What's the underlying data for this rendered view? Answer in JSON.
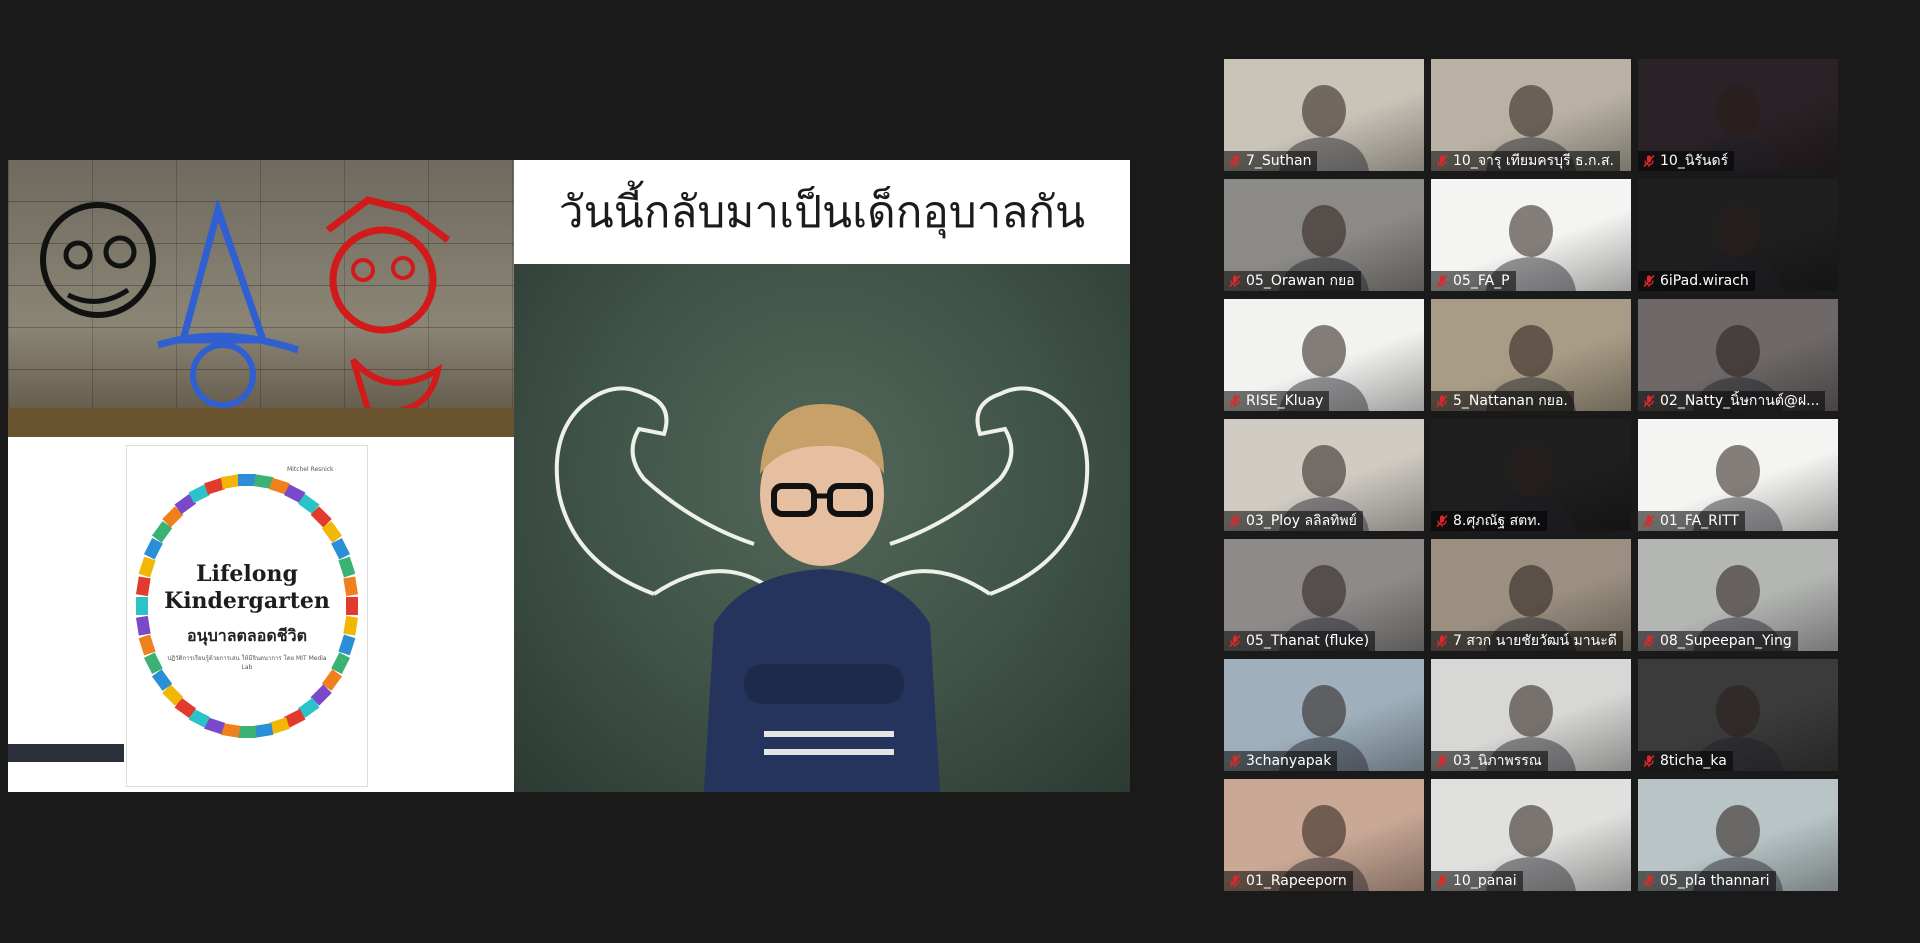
{
  "shared_screen": {
    "slide_title": "วันนี้กลับมาเป็นเด็กอุบาลกัน",
    "book": {
      "author": "Mitchel Resnick",
      "title_line1": "Lifelong",
      "title_line2": "Kindergarten",
      "thai_title": "อนุบาลตลอดชีวิต",
      "subtitle": "ปฏิวัติการเรียนรู้ด้วยการเล่น ให้มีจินตนาการ โดย MIT Media Lab"
    }
  },
  "participants": [
    {
      "name": "7_Suthan",
      "bg": "#c9c4b8",
      "muted": true
    },
    {
      "name": "10_จารุ  เทียมครบุรี  ธ.ก.ส.",
      "bg": "#b9b2a4",
      "muted": true
    },
    {
      "name": "10_นิรันดร์",
      "bg": "#2a2226",
      "muted": true
    },
    {
      "name": "05_Orawan กยอ",
      "bg": "#8c8a86",
      "muted": true
    },
    {
      "name": "05_FA_P",
      "bg": "#f4f4f2",
      "muted": true
    },
    {
      "name": "6iPad.wirach",
      "bg": "#1f1f1f",
      "muted": true
    },
    {
      "name": "RISE_Kluay",
      "bg": "#f2f2f0",
      "muted": true
    },
    {
      "name": "5_Nattanan กยอ.",
      "bg": "#a89c86",
      "muted": true
    },
    {
      "name": "02_Natty_นิ้ษกานต์@ฝ...",
      "bg": "#6e6868",
      "muted": true
    },
    {
      "name": "03_Ploy ลลิลทิพย์",
      "bg": "#d0ccc4",
      "muted": true
    },
    {
      "name": "8.ศุภณัฐ สตท.",
      "bg": "#1f1f1f",
      "muted": true
    },
    {
      "name": "01_FA_RITT",
      "bg": "#f4f4f2",
      "muted": true
    },
    {
      "name": "05_Thanat (fluke)",
      "bg": "#8e8a8a",
      "muted": true
    },
    {
      "name": "7 สวก นายชัยวัฒน์ มานะดี",
      "bg": "#9a8f80",
      "muted": true
    },
    {
      "name": "08_Supeepan_Ying",
      "bg": "#b4b6b4",
      "muted": true
    },
    {
      "name": "3chanyapak",
      "bg": "#9fb0bc",
      "muted": true
    },
    {
      "name": "03_นิภาพรรณ",
      "bg": "#d7d7d5",
      "muted": true
    },
    {
      "name": "8ticha_ka",
      "bg": "#3b3b3b",
      "muted": true
    },
    {
      "name": "01_Rapeeporn",
      "bg": "#c9a896",
      "muted": true
    },
    {
      "name": "10_panai",
      "bg": "#e0e0de",
      "muted": true
    },
    {
      "name": "05_pla thannari",
      "bg": "#b8c4c6",
      "muted": true
    }
  ],
  "icons": {
    "mic": "mic-muted-icon"
  },
  "colors": {
    "muted_mic": "#e02828",
    "window_bg": "#1a1a1a"
  }
}
